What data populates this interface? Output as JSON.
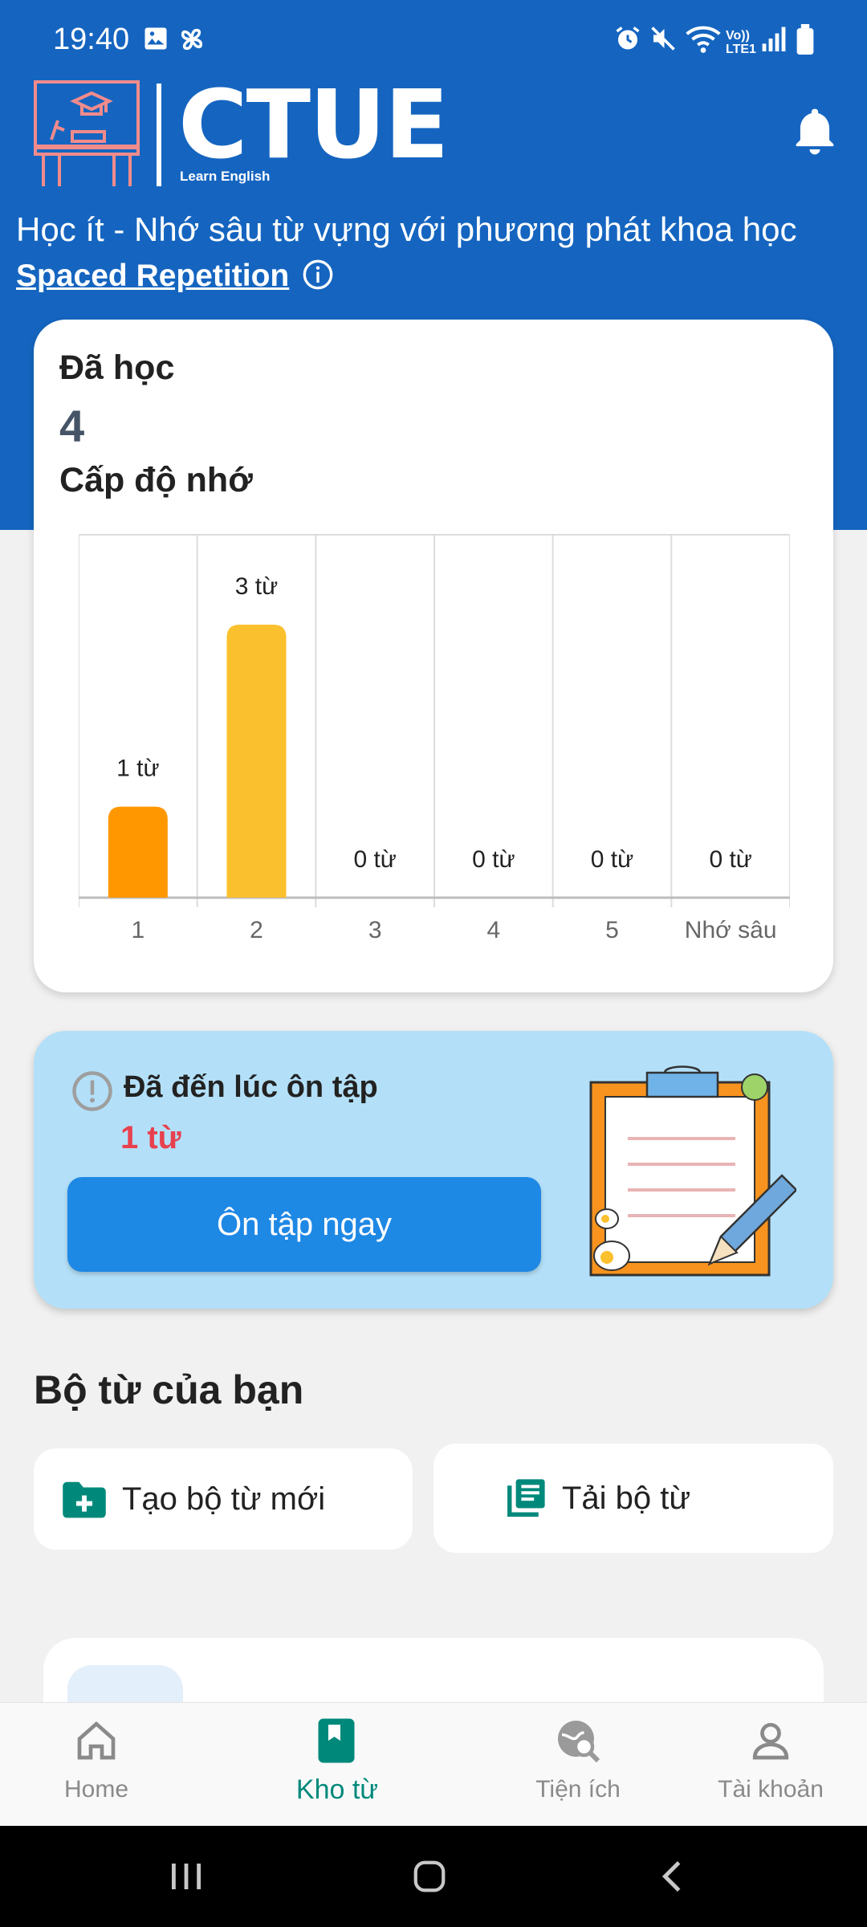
{
  "status_bar": {
    "time": "19:40",
    "network_label": "Vo)) LTE1"
  },
  "header": {
    "brand_name": "CTUE",
    "brand_subtitle": "Learn English",
    "tagline": "Học ít - Nhớ sâu từ vựng với phương phát khoa học",
    "link_label": "Spaced Repetition"
  },
  "stats": {
    "learned_label": "Đã học",
    "learned_value": "4",
    "memory_label": "Cấp độ nhớ"
  },
  "chart_data": {
    "type": "bar",
    "categories": [
      "1",
      "2",
      "3",
      "4",
      "5",
      "Nhớ sâu"
    ],
    "values": [
      1,
      3,
      0,
      0,
      0,
      0
    ],
    "data_labels": [
      "1 từ",
      "3 từ",
      "0 từ",
      "0 từ",
      "0 từ",
      "0 từ"
    ],
    "bar_colors": [
      "#ff9800",
      "#fbc02d",
      "#fbc02d",
      "#fbc02d",
      "#fbc02d",
      "#fbc02d"
    ],
    "ylim": [
      0,
      4
    ],
    "grid": true
  },
  "review": {
    "title": "Đã đến lúc ôn tập",
    "count": "1 từ",
    "button_label": "Ôn tập ngay"
  },
  "sets": {
    "title": "Bộ từ của bạn",
    "create_label": "Tạo bộ từ mới",
    "download_label": "Tải bộ từ"
  },
  "bottom_nav": {
    "items": [
      {
        "label": "Home",
        "icon": "home-icon",
        "active": false
      },
      {
        "label": "Kho từ",
        "icon": "bookmark-book-icon",
        "active": true
      },
      {
        "label": "Tiện ích",
        "icon": "globe-search-icon",
        "active": false
      },
      {
        "label": "Tài khoản",
        "icon": "person-icon",
        "active": false
      }
    ]
  },
  "colors": {
    "header_blue": "#1565c0",
    "accent_teal": "#00897b",
    "review_bg": "#b3e0f8",
    "button_blue": "#1e88e5",
    "count_red": "#e8414e"
  }
}
